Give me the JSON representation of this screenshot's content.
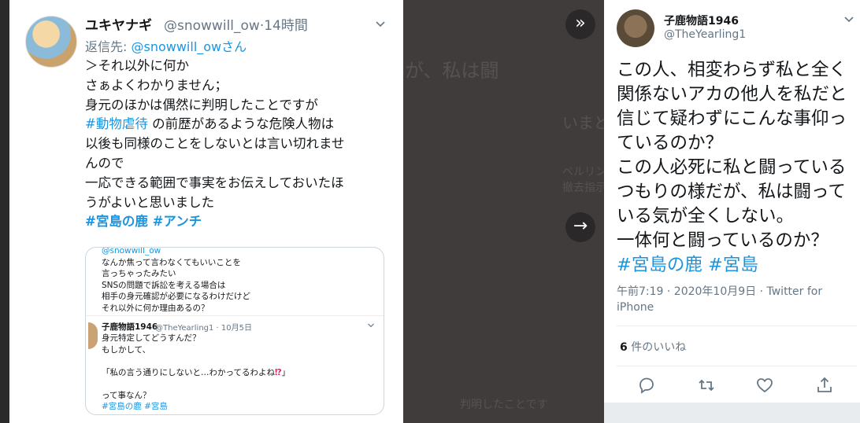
{
  "left_tweet": {
    "name": "ユキヤナギ",
    "handle": "@snowwill_ow",
    "time": "·14時間",
    "reply_prefix": "返信先: ",
    "reply_to": "@snowwill_owさん",
    "lines": [
      "＞それ以外に何か",
      "さぁよくわかりません；",
      "身元のほかは偶然に判明したことですが",
      "以後も同様のことをしないとは言い切れませ",
      "んので",
      "一応できる範囲で事実をお伝えしておいたほ",
      "うがよいと思いました"
    ],
    "tag_abuse": "#動物虐待",
    "line4_rest": " の前歴があるような危険人物は",
    "tags_end": "#宮島の鹿 #アンチ",
    "quote": {
      "top_handle": "@snowwill_ow",
      "top_lines": "なんか焦って言わなくてもいいことを\n言っちゃったみたい\nSNSの問題で訴訟を考える場合は\n相手の身元確認が必要になるわけだけど\nそれ以外に何か理由あるの？",
      "name": "子鹿物語1946",
      "meta": "@TheYearling1 · 10月5日",
      "body_a": "身元特定してどうすんだ？\nもしかして、\n\n「私の言う通りにしないと…わかってるわよね",
      "bang": "⁉",
      "body_b": "」\n\nって事なん？\n",
      "tags": "#宮島の鹿 #宮島"
    }
  },
  "background": {
    "texts": [
      "が、私は闘",
      "いまど",
      "ベルリン",
      "撤去指示",
      "判明したことです"
    ]
  },
  "nav": {
    "prev": "»",
    "next": "→"
  },
  "right_tweet": {
    "name": "子鹿物語1946",
    "handle": "@TheYearling1",
    "body": "この人、相変わらず私と全く関係ないアカの他人を私だと信じて疑わずにこんな事仰っているのか？\nこの人必死に私と闘っているつもりの様だが、私は闘っている気が全くしない。\n一体何と闘っているのか？\n",
    "tags": "#宮島の鹿 #宮島",
    "meta": "午前7:19 · 2020年10月9日 · Twitter for iPhone",
    "likes_count": "6",
    "likes_label": " 件のいいね"
  },
  "icons": {
    "reply": "reply-icon",
    "retweet": "retweet-icon",
    "like": "heart-icon",
    "share": "share-icon",
    "caret": "chevron-down-icon"
  }
}
